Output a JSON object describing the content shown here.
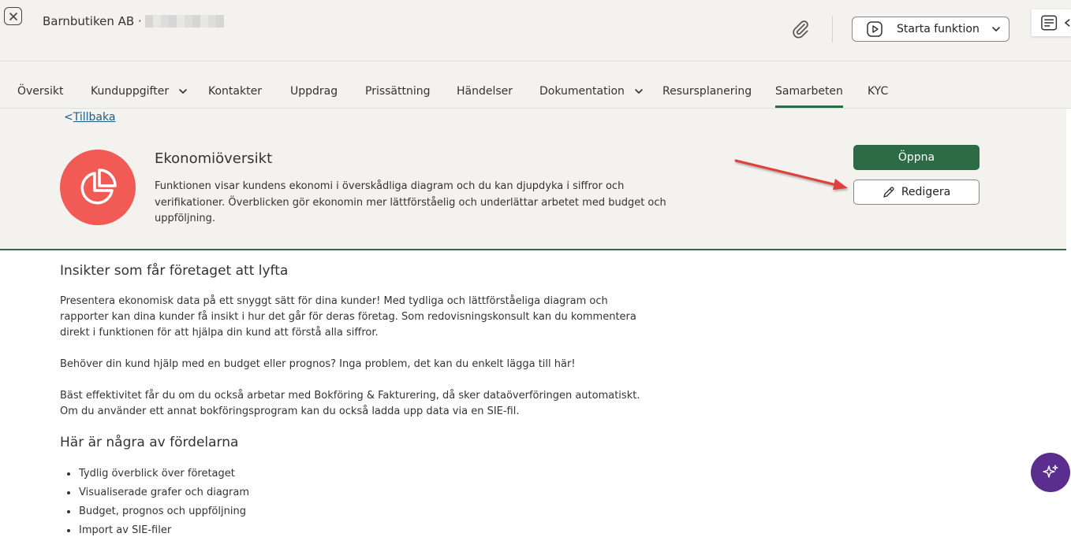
{
  "header": {
    "company": "Barnbutiken AB ·",
    "start_label": "Starta funktion"
  },
  "tabs": [
    {
      "label": "Översikt"
    },
    {
      "label": "Kunduppgifter"
    },
    {
      "label": "Kontakter"
    },
    {
      "label": "Uppdrag"
    },
    {
      "label": "Prissättning"
    },
    {
      "label": "Händelser"
    },
    {
      "label": "Dokumentation"
    },
    {
      "label": "Resursplanering"
    },
    {
      "label": "Samarbeten"
    },
    {
      "label": "KYC"
    }
  ],
  "panel": {
    "back_prefix": "<",
    "back_label": "Tillbaka",
    "title": "Ekonomiöversikt",
    "description": "Funktionen visar kundens ekonomi i överskådliga diagram och du kan djupdyka i siffror och verifikationer. Överblicken gör ekonomin mer lättförståelig och underlättar arbetet med budget och uppföljning.",
    "open_label": "Öppna",
    "edit_label": "Redigera"
  },
  "content": {
    "heading1": "Insikter som får företaget att lyfta",
    "para1": "Presentera ekonomisk data på ett snyggt sätt för dina kunder! Med tydliga och lättförståeliga diagram och rapporter kan dina kunder få insikt i hur det går för deras företag. Som redovisningskonsult kan du kommentera direkt i funktionen för att hjälpa din kund att förstå alla siffror.",
    "para2": "Behöver din kund hjälp med en budget eller prognos? Inga problem, det kan du enkelt lägga till här!",
    "para3a": "Bäst effektivitet får du om du också arbetar med Bokföring & Fakturering, då sker dataöverföringen automatiskt.",
    "para3b": "Om du använder ett annat bokföringsprogram kan du också ladda upp data via en SIE-fil.",
    "heading2": "Här är några av fördelarna",
    "bullets": [
      "Tydlig överblick över företaget",
      "Visualiserade grafer och diagram",
      "Budget, prognos och uppföljning",
      "Import av SIE-filer"
    ]
  },
  "colors": {
    "brand_green": "#2c6b45",
    "function_icon": "#f25b55",
    "ai_button": "#5b2d8e",
    "annotation_arrow": "#e0403a"
  },
  "icons": {
    "close": "close-icon",
    "attachment": "paperclip-icon",
    "start": "play-icon",
    "notes": "notes-icon",
    "function": "pie-chart-icon",
    "edit": "pencil-icon",
    "ai": "sparkle-icon"
  }
}
